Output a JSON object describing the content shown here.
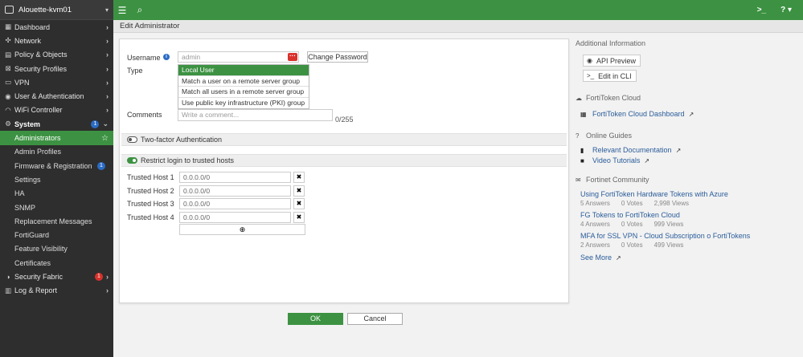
{
  "sidebar": {
    "host": "Alouette-kvm01",
    "items": [
      {
        "label": "Dashboard",
        "icon": "dashboard-icon",
        "glyph": "▦"
      },
      {
        "label": "Network",
        "icon": "network-icon",
        "glyph": "✣"
      },
      {
        "label": "Policy & Objects",
        "icon": "policy-icon",
        "glyph": "▤"
      },
      {
        "label": "Security Profiles",
        "icon": "lock-icon",
        "glyph": "⊠"
      },
      {
        "label": "VPN",
        "icon": "vpn-icon",
        "glyph": "▭"
      },
      {
        "label": "User & Authentication",
        "icon": "user-icon",
        "glyph": "◉"
      },
      {
        "label": "WiFi Controller",
        "icon": "wifi-icon",
        "glyph": "◠"
      }
    ],
    "system": {
      "label": "System",
      "badge": "1"
    },
    "sub": [
      {
        "label": "Administrators",
        "active": true
      },
      {
        "label": "Admin Profiles"
      },
      {
        "label": "Firmware & Registration",
        "badge": "1"
      },
      {
        "label": "Settings"
      },
      {
        "label": "HA"
      },
      {
        "label": "SNMP"
      },
      {
        "label": "Replacement Messages"
      },
      {
        "label": "FortiGuard"
      },
      {
        "label": "Feature Visibility"
      },
      {
        "label": "Certificates"
      }
    ],
    "fabric": {
      "label": "Security Fabric",
      "badge": "1"
    },
    "log": {
      "label": "Log & Report"
    }
  },
  "page": {
    "title": "Edit Administrator"
  },
  "form": {
    "username_label": "Username",
    "username_value": "admin",
    "change_password": "Change Password",
    "type_label": "Type",
    "type_options": [
      "Local User",
      "Match a user on a remote server group",
      "Match all users in a remote server group",
      "Use public key infrastructure (PKI) group"
    ],
    "comments_label": "Comments",
    "comments_placeholder": "Write a comment...",
    "comments_count": "0/255",
    "two_factor": "Two-factor Authentication",
    "restrict": "Restrict login to trusted hosts",
    "trusted_hosts": [
      {
        "label": "Trusted Host 1",
        "value": "0.0.0.0/0"
      },
      {
        "label": "Trusted Host 2",
        "value": "0.0.0.0/0"
      },
      {
        "label": "Trusted Host 3",
        "value": "0.0.0.0/0"
      },
      {
        "label": "Trusted Host 4",
        "value": "0.0.0.0/0"
      }
    ]
  },
  "footer": {
    "ok": "OK",
    "cancel": "Cancel"
  },
  "right": {
    "additional_info": "Additional Information",
    "api_preview": "API Preview",
    "edit_cli": "Edit in CLI",
    "fortitoken_head": "FortiToken Cloud",
    "fortitoken_link": "FortiToken Cloud Dashboard",
    "guides_head": "Online Guides",
    "guides": [
      "Relevant Documentation",
      "Video Tutorials"
    ],
    "community_head": "Fortinet Community",
    "community": [
      {
        "title": "Using FortiToken Hardware Tokens with Azure",
        "answers": "5 Answers",
        "votes": "0 Votes",
        "views": "2,998 Views"
      },
      {
        "title": "FG Tokens to FortiToken Cloud",
        "answers": "4 Answers",
        "votes": "0 Votes",
        "views": "999 Views"
      },
      {
        "title": "MFA for SSL VPN - Cloud Subscription o FortiTokens",
        "answers": "2 Answers",
        "votes": "0 Votes",
        "views": "499 Views"
      }
    ],
    "see_more": "See More"
  },
  "colors": {
    "accent": "#3c9242",
    "sidebar": "#2e2e2e",
    "badge_blue": "#2b6cc4",
    "badge_red": "#d9312b",
    "link": "#2a5c9a"
  }
}
